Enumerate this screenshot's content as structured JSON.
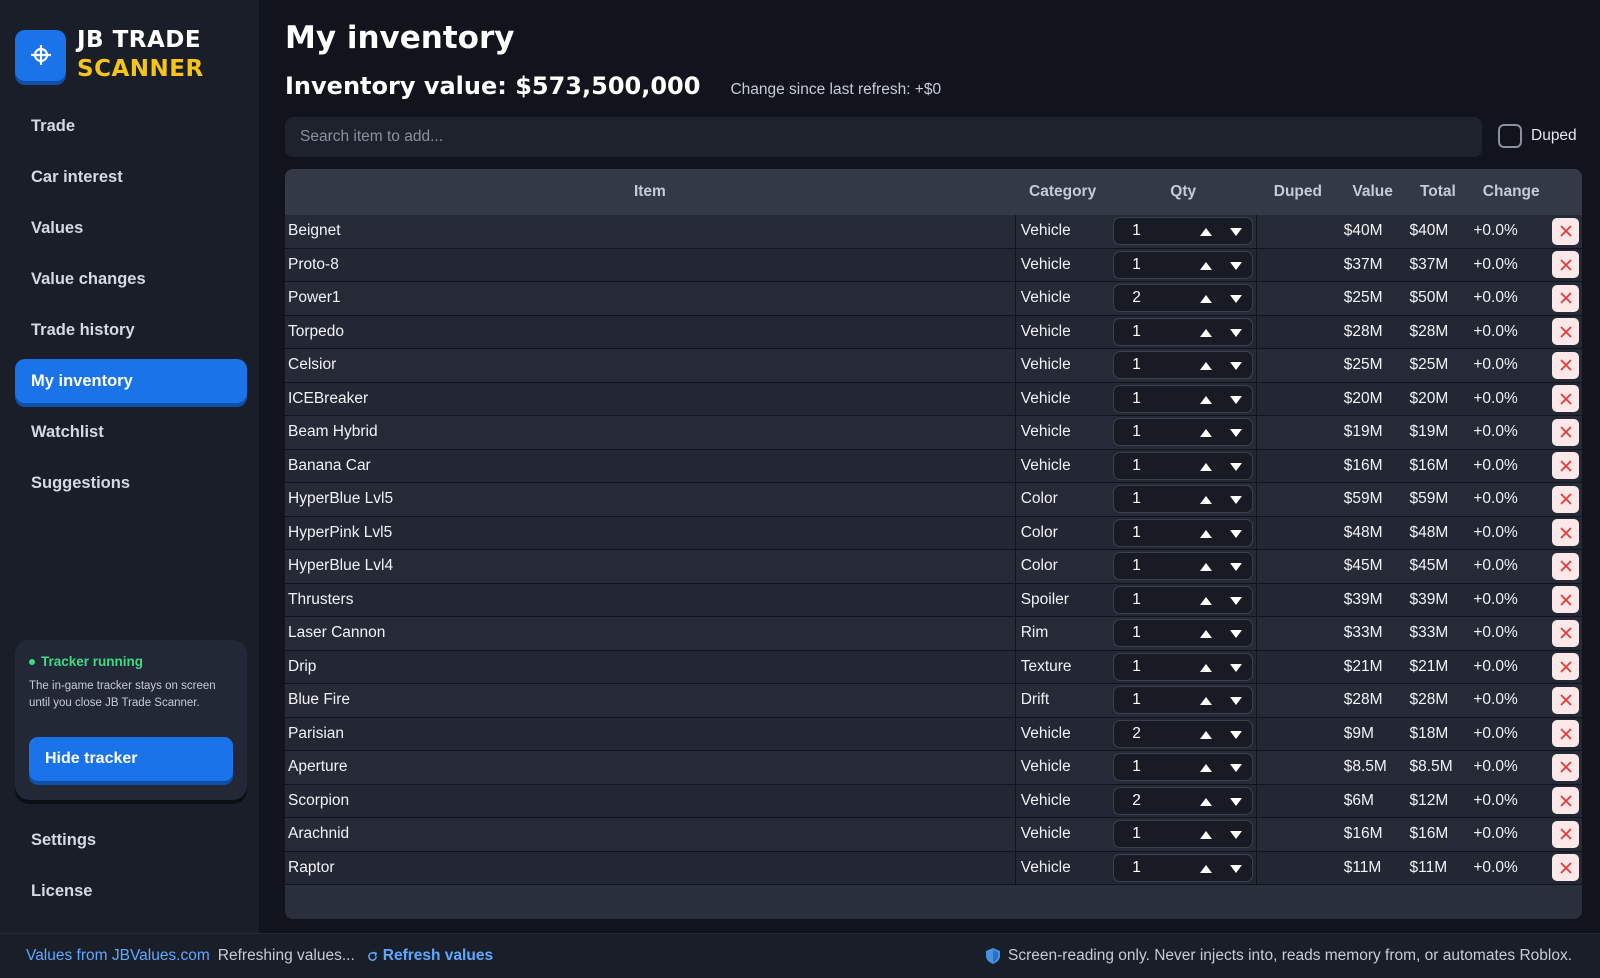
{
  "app": {
    "logo_line1": "JB TRADE",
    "logo_line2": "SCANNER",
    "accent": "#1a73e8",
    "logo_accent": "#f5c518"
  },
  "sidebar": {
    "items": [
      {
        "label": "Trade",
        "active": false
      },
      {
        "label": "Car interest",
        "active": false
      },
      {
        "label": "Values",
        "active": false
      },
      {
        "label": "Value changes",
        "active": false
      },
      {
        "label": "Trade history",
        "active": false
      },
      {
        "label": "My inventory",
        "active": true
      },
      {
        "label": "Watchlist",
        "active": false
      },
      {
        "label": "Suggestions",
        "active": false
      }
    ],
    "bottom_items": [
      {
        "label": "Settings"
      },
      {
        "label": "License"
      }
    ],
    "tracker": {
      "status": "Tracker running",
      "description": "The in-game tracker stays on screen until you close JB Trade Scanner.",
      "button": "Hide tracker"
    }
  },
  "main": {
    "title": "My inventory",
    "inventory_value": "Inventory value: $573,500,000",
    "change_text": "Change since last refresh: +$0",
    "search_placeholder": "Search item to add...",
    "duped_filter_label": "Duped",
    "duped_filter_checked": false
  },
  "table": {
    "headers": {
      "item": "Item",
      "category": "Category",
      "qty": "Qty",
      "duped": "Duped",
      "value": "Value",
      "total": "Total",
      "change": "Change"
    },
    "rows": [
      {
        "item": "Beignet",
        "category": "Vehicle",
        "qty": "1",
        "duped": "",
        "value": "$40M",
        "total": "$40M",
        "change": "+0.0%"
      },
      {
        "item": "Proto-8",
        "category": "Vehicle",
        "qty": "1",
        "duped": "",
        "value": "$37M",
        "total": "$37M",
        "change": "+0.0%"
      },
      {
        "item": "Power1",
        "category": "Vehicle",
        "qty": "2",
        "duped": "",
        "value": "$25M",
        "total": "$50M",
        "change": "+0.0%"
      },
      {
        "item": "Torpedo",
        "category": "Vehicle",
        "qty": "1",
        "duped": "",
        "value": "$28M",
        "total": "$28M",
        "change": "+0.0%"
      },
      {
        "item": "Celsior",
        "category": "Vehicle",
        "qty": "1",
        "duped": "",
        "value": "$25M",
        "total": "$25M",
        "change": "+0.0%"
      },
      {
        "item": "ICEBreaker",
        "category": "Vehicle",
        "qty": "1",
        "duped": "",
        "value": "$20M",
        "total": "$20M",
        "change": "+0.0%"
      },
      {
        "item": "Beam Hybrid",
        "category": "Vehicle",
        "qty": "1",
        "duped": "",
        "value": "$19M",
        "total": "$19M",
        "change": "+0.0%"
      },
      {
        "item": "Banana Car",
        "category": "Vehicle",
        "qty": "1",
        "duped": "",
        "value": "$16M",
        "total": "$16M",
        "change": "+0.0%"
      },
      {
        "item": "HyperBlue Lvl5",
        "category": "Color",
        "qty": "1",
        "duped": "",
        "value": "$59M",
        "total": "$59M",
        "change": "+0.0%"
      },
      {
        "item": "HyperPink Lvl5",
        "category": "Color",
        "qty": "1",
        "duped": "",
        "value": "$48M",
        "total": "$48M",
        "change": "+0.0%"
      },
      {
        "item": "HyperBlue Lvl4",
        "category": "Color",
        "qty": "1",
        "duped": "",
        "value": "$45M",
        "total": "$45M",
        "change": "+0.0%"
      },
      {
        "item": "Thrusters",
        "category": "Spoiler",
        "qty": "1",
        "duped": "",
        "value": "$39M",
        "total": "$39M",
        "change": "+0.0%"
      },
      {
        "item": "Laser Cannon",
        "category": "Rim",
        "qty": "1",
        "duped": "",
        "value": "$33M",
        "total": "$33M",
        "change": "+0.0%"
      },
      {
        "item": "Drip",
        "category": "Texture",
        "qty": "1",
        "duped": "",
        "value": "$21M",
        "total": "$21M",
        "change": "+0.0%"
      },
      {
        "item": "Blue Fire",
        "category": "Drift",
        "qty": "1",
        "duped": "",
        "value": "$28M",
        "total": "$28M",
        "change": "+0.0%"
      },
      {
        "item": "Parisian",
        "category": "Vehicle",
        "qty": "2",
        "duped": "",
        "value": "$9M",
        "total": "$18M",
        "change": "+0.0%"
      },
      {
        "item": "Aperture",
        "category": "Vehicle",
        "qty": "1",
        "duped": "",
        "value": "$8.5M",
        "total": "$8.5M",
        "change": "+0.0%"
      },
      {
        "item": "Scorpion",
        "category": "Vehicle",
        "qty": "2",
        "duped": "",
        "value": "$6M",
        "total": "$12M",
        "change": "+0.0%"
      },
      {
        "item": "Arachnid",
        "category": "Vehicle",
        "qty": "1",
        "duped": "",
        "value": "$16M",
        "total": "$16M",
        "change": "+0.0%"
      },
      {
        "item": "Raptor",
        "category": "Vehicle",
        "qty": "1",
        "duped": "",
        "value": "$11M",
        "total": "$11M",
        "change": "+0.0%"
      }
    ]
  },
  "footer": {
    "source_link": "Values from JBValues.com",
    "status": "Refreshing values...",
    "refresh_button": "Refresh values",
    "note": "Screen-reading only. Never injects into, reads memory from, or automates Roblox."
  },
  "icons": {
    "logo": "crosshair-icon",
    "qty_up": "triangle-up-icon",
    "qty_down": "triangle-down-icon",
    "delete": "close-icon",
    "refresh": "refresh-icon",
    "note": "shield-icon"
  }
}
